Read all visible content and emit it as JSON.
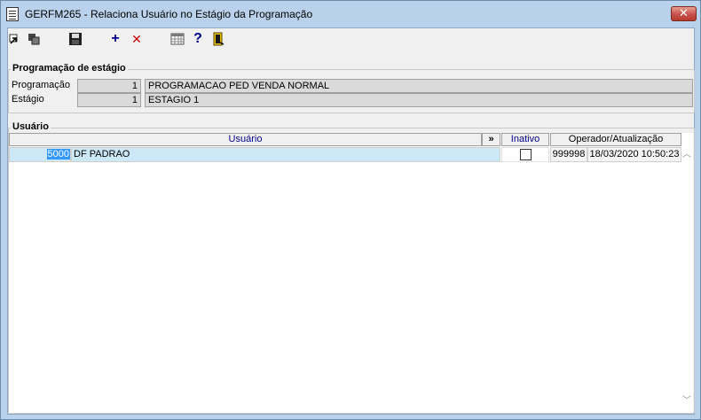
{
  "window": {
    "title": "GERFM265 - Relaciona Usuário no Estágio da Programação",
    "close_label": "✕"
  },
  "toolbar": {
    "icons": [
      "navigate-in-icon",
      "navigate-copy-icon",
      "save-icon",
      "add-icon",
      "delete-icon",
      "calendar-grid-icon",
      "help-icon",
      "exit-door-icon"
    ],
    "add_label": "+",
    "delete_label": "✕",
    "help_label": "?"
  },
  "programacao_group": {
    "title": "Programação de estágio",
    "programacao_label": "Programação",
    "programacao_code": "1",
    "programacao_desc": "PROGRAMACAO PED VENDA NORMAL",
    "estagio_label": "Estágio",
    "estagio_code": "1",
    "estagio_desc": "ESTAGIO 1"
  },
  "usuario_group": {
    "title": "Usuário",
    "columns": {
      "usuario": "Usuário",
      "expand": "»",
      "inativo": "Inativo",
      "operador": "Operador/Atualização"
    },
    "rows": [
      {
        "code": "5000",
        "name": "DF PADRAO",
        "inativo": false,
        "operador": "999998",
        "atualizacao": "18/03/2020 10:50:23"
      }
    ]
  },
  "colors": {
    "title_bar": "#b9d1ea",
    "selection": "#3399ff",
    "row_highlight": "#cce8f6",
    "header_text": "#00008b",
    "close_button": "#c75050"
  }
}
